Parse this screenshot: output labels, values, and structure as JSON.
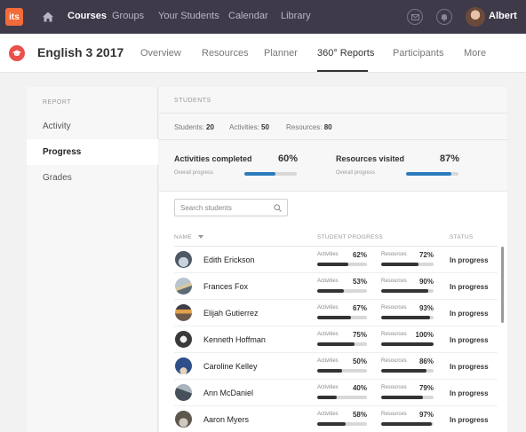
{
  "topnav": {
    "logo": "its",
    "items": [
      {
        "label": "Courses",
        "active": true
      },
      {
        "label": "Groups",
        "active": false
      },
      {
        "label": "Your Students",
        "active": false
      },
      {
        "label": "Calendar",
        "active": false
      },
      {
        "label": "Library",
        "active": false
      }
    ],
    "user": "Albert"
  },
  "course": {
    "title": "English 3 2017",
    "tabs": [
      {
        "label": "Overview",
        "active": false
      },
      {
        "label": "Resources",
        "active": false
      },
      {
        "label": "Planner",
        "active": false
      },
      {
        "label": "360° Reports",
        "active": true
      },
      {
        "label": "Participants",
        "active": false
      },
      {
        "label": "More",
        "active": false
      }
    ]
  },
  "sidebar": {
    "heading": "REPORT",
    "items": [
      {
        "label": "Activity",
        "active": false
      },
      {
        "label": "Progress",
        "active": true
      },
      {
        "label": "Grades",
        "active": false
      }
    ]
  },
  "students": {
    "heading": "STUDENTS",
    "summary": {
      "students_label": "Students:",
      "students_value": "20",
      "activities_label": "Activities:",
      "activities_value": "50",
      "resources_label": "Resources:",
      "resources_value": "80"
    },
    "stats": {
      "activities": {
        "label": "Activities completed",
        "sub": "Overall progress",
        "pct_text": "60%",
        "pct": 60
      },
      "resources": {
        "label": "Resources visited",
        "sub": "Overall progress",
        "pct_text": "87%",
        "pct": 87
      }
    },
    "search_placeholder": "Search students",
    "columns": {
      "name": "NAME",
      "progress": "STUDENT PROGRESS",
      "status": "STATUS"
    },
    "activities_label": "Activities",
    "resources_label": "Resources",
    "rows": [
      {
        "name": "Edith Erickson",
        "act_text": "62%",
        "act": 62,
        "res_text": "72%",
        "res": 72,
        "status": "In progress"
      },
      {
        "name": "Frances Fox",
        "act_text": "53%",
        "act": 53,
        "res_text": "90%",
        "res": 90,
        "status": "In progress"
      },
      {
        "name": "Elijah Gutierrez",
        "act_text": "67%",
        "act": 67,
        "res_text": "93%",
        "res": 93,
        "status": "In progress"
      },
      {
        "name": "Kenneth Hoffman",
        "act_text": "75%",
        "act": 75,
        "res_text": "100%",
        "res": 100,
        "status": "In progress"
      },
      {
        "name": "Caroline Kelley",
        "act_text": "50%",
        "act": 50,
        "res_text": "86%",
        "res": 86,
        "status": "In progress"
      },
      {
        "name": "Ann McDaniel",
        "act_text": "40%",
        "act": 40,
        "res_text": "79%",
        "res": 79,
        "status": "In progress"
      },
      {
        "name": "Aaron Myers",
        "act_text": "58%",
        "act": 58,
        "res_text": "97%",
        "res": 97,
        "status": "In progress"
      }
    ]
  },
  "colors": {
    "topnav": "#3e3a4a",
    "accent": "#2b7bbd",
    "logo": "#f26b3a",
    "course_badge": "#e9514a"
  }
}
